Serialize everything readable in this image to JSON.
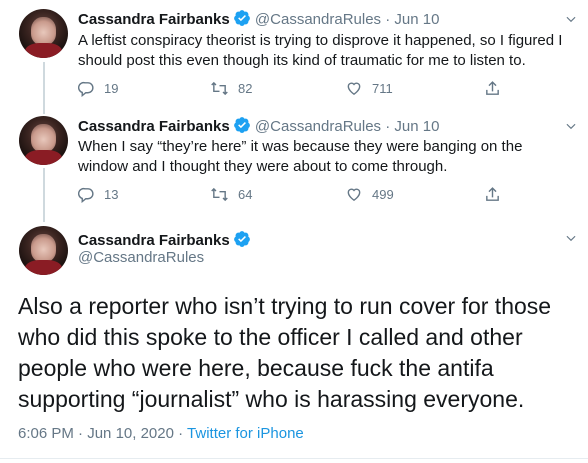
{
  "tweets": [
    {
      "name": "Cassandra Fairbanks",
      "handle": "@CassandraRules",
      "separator": "·",
      "date": "Jun 10",
      "text": "A leftist conspiracy theorist is trying to disprove it happened, so I figured I should post this even though its kind of traumatic for me to listen to.",
      "replies": "19",
      "retweets": "82",
      "likes": "711"
    },
    {
      "name": "Cassandra Fairbanks",
      "handle": "@CassandraRules",
      "separator": "·",
      "date": "Jun 10",
      "text": "When I say “they’re here” it was because they were banging on the window and I thought they were about to come through.",
      "replies": "13",
      "retweets": "64",
      "likes": "499"
    }
  ],
  "main_tweet": {
    "name": "Cassandra Fairbanks",
    "handle": "@CassandraRules",
    "text": "Also a reporter who isn’t trying to run cover for those who did this spoke to the officer I called and other people who were here, because fuck the antifa supporting “journalist” who is harassing everyone.",
    "time": "6:06 PM",
    "separator": "·",
    "date": "Jun 10, 2020",
    "separator2": "·",
    "source": "Twitter for iPhone"
  },
  "icons": {
    "verified": "verified-badge-icon",
    "reply": "reply-icon",
    "retweet": "retweet-icon",
    "like": "heart-icon",
    "share": "share-icon",
    "more": "chevron-down-icon"
  },
  "colors": {
    "verified": "#1da1f2",
    "link": "#1b95e0",
    "muted": "#657786",
    "text": "#14171a"
  }
}
